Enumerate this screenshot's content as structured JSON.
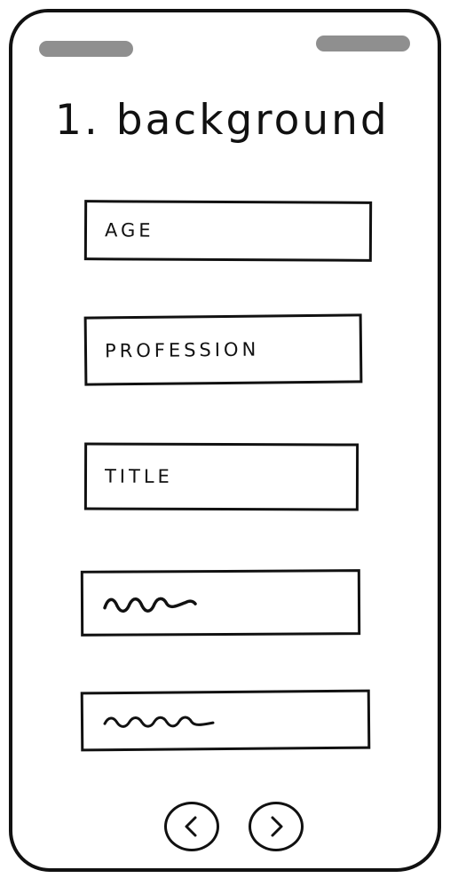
{
  "header": {
    "title": "1. background"
  },
  "form": {
    "fields": [
      {
        "label": "AGE"
      },
      {
        "label": "PROFESSION"
      },
      {
        "label": "TITLE"
      },
      {
        "placeholder_icon": "squiggle-placeholder-icon"
      },
      {
        "placeholder_icon": "squiggle-placeholder-icon"
      }
    ]
  },
  "navigation": {
    "prev_icon": "chevron-left-icon",
    "next_icon": "chevron-right-icon"
  }
}
